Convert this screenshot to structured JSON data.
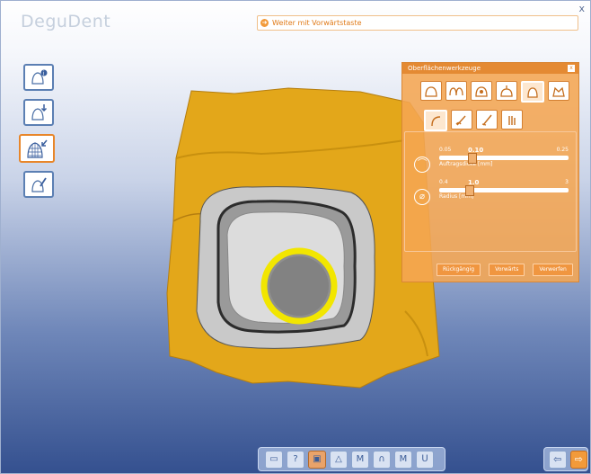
{
  "app": {
    "logo": "DeguDent",
    "close": "x"
  },
  "hint": {
    "icon": "arrow-right-circle-icon",
    "text": "Weiter mit Vorwärtstaste"
  },
  "left_tools": [
    "crown-info-icon",
    "crown-download-icon",
    "mesh-adapt-icon",
    "crown-edit-icon"
  ],
  "panel": {
    "title": "Oberflächenwerkzeuge",
    "close": "x",
    "sliders": [
      {
        "min": "0.05",
        "max": "0.25",
        "value": "0.10",
        "fraction": 0.25,
        "label": "Auftragsdicke [mm]"
      },
      {
        "min": "0.4",
        "max": "3",
        "value": "1.0",
        "fraction": 0.23,
        "label": "Radius [mm]"
      }
    ],
    "buttons": {
      "undo": "Rückgängig",
      "redo": "Vorwärts",
      "discard": "Verwerfen"
    }
  },
  "bottom_toolbar": {
    "help": "?"
  },
  "colors": {
    "accent": "#f29a3a",
    "model": "#e3a71a",
    "ring": "#f2e600"
  }
}
